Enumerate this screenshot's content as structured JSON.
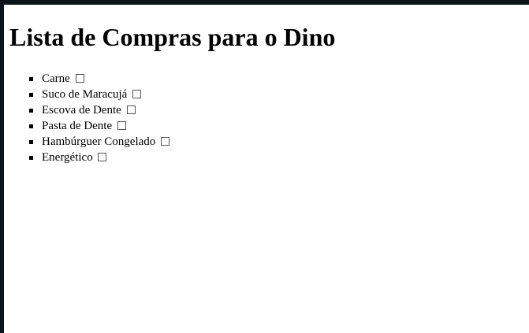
{
  "page": {
    "title": "Lista de Compras para o Dino"
  },
  "list": {
    "items": [
      {
        "label": "Carne",
        "checked": false
      },
      {
        "label": "Suco de Maracujá",
        "checked": false
      },
      {
        "label": "Escova de Dente",
        "checked": false
      },
      {
        "label": "Pasta de Dente",
        "checked": false
      },
      {
        "label": "Hambúrguer Congelado",
        "checked": false
      },
      {
        "label": "Energético",
        "checked": false
      }
    ]
  }
}
